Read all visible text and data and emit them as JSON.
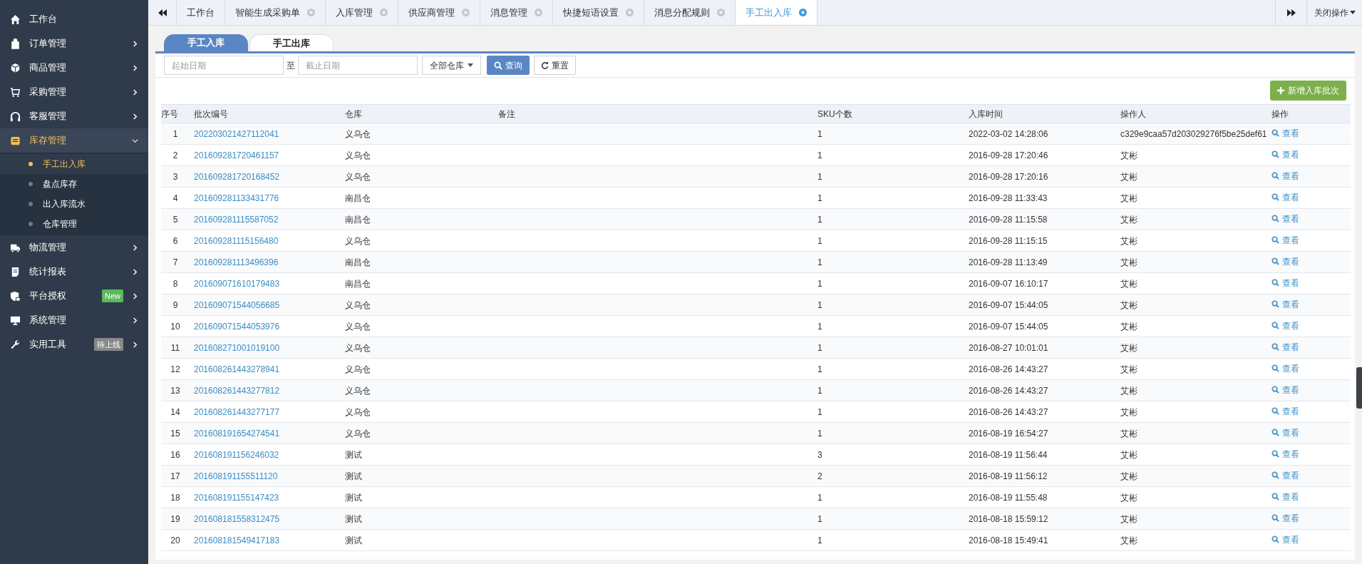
{
  "sidebar": {
    "items": [
      {
        "label": "工作台",
        "kind": "link",
        "selected": false
      },
      {
        "label": "订单管理",
        "kind": "menu",
        "selected": false,
        "expanded": false
      },
      {
        "label": "商品管理",
        "kind": "menu",
        "selected": false,
        "expanded": false
      },
      {
        "label": "采购管理",
        "kind": "menu",
        "selected": false,
        "expanded": false
      },
      {
        "label": "客服管理",
        "kind": "menu",
        "selected": false,
        "expanded": false
      },
      {
        "label": "库存管理",
        "kind": "menu",
        "selected": true,
        "expanded": true,
        "children": [
          {
            "label": "手工出入库",
            "selected": true
          },
          {
            "label": "盘点库存",
            "selected": false
          },
          {
            "label": "出入库流水",
            "selected": false
          },
          {
            "label": "仓库管理",
            "selected": false
          }
        ]
      },
      {
        "label": "物流管理",
        "kind": "menu",
        "selected": false,
        "expanded": false
      },
      {
        "label": "统计报表",
        "kind": "menu",
        "selected": false,
        "expanded": false
      },
      {
        "label": "平台授权",
        "kind": "menu",
        "selected": false,
        "expanded": false,
        "badge": {
          "text": "New",
          "color": "#5cb85c"
        }
      },
      {
        "label": "系统管理",
        "kind": "menu",
        "selected": false,
        "expanded": false
      },
      {
        "label": "实用工具",
        "kind": "menu",
        "selected": false,
        "expanded": false,
        "badge": {
          "text": "待上线",
          "color": "#888888"
        }
      }
    ]
  },
  "tabs": [
    {
      "label": "工作台",
      "selected": false,
      "closable": false
    },
    {
      "label": "智能生成采购单",
      "selected": false,
      "closable": true
    },
    {
      "label": "入库管理",
      "selected": false,
      "closable": true
    },
    {
      "label": "供应商管理",
      "selected": false,
      "closable": true
    },
    {
      "label": "消息管理",
      "selected": false,
      "closable": true
    },
    {
      "label": "快捷短语设置",
      "selected": false,
      "closable": true
    },
    {
      "label": "消息分配规则",
      "selected": false,
      "closable": true
    },
    {
      "label": "手工出入库",
      "selected": true,
      "closable": true
    }
  ],
  "tab_menu": {
    "label": "关闭操作"
  },
  "subtabs": [
    {
      "label": "手工入库",
      "selected": true
    },
    {
      "label": "手工出库",
      "selected": false
    }
  ],
  "filters": {
    "start_date": {
      "placeholder": "起始日期"
    },
    "separator": "至",
    "end_date": {
      "placeholder": "截止日期"
    },
    "warehouse": {
      "value": "全部仓库"
    },
    "query_button": "查询",
    "reset_button": "重置"
  },
  "add_button": "新增入库批次",
  "table": {
    "columns": [
      "序号",
      "批次编号",
      "仓库",
      "备注",
      "SKU个数",
      "入库时间",
      "操作人",
      "操作"
    ],
    "rows": [
      {
        "no": "1",
        "batch": "202203021427112041",
        "warehouse": "义乌仓",
        "sku": "1",
        "time": "2022-03-02 14:28:06",
        "operator": "c329e9caa57d203029276f5be25def61",
        "action": "查看"
      },
      {
        "no": "2",
        "batch": "201609281720461157",
        "warehouse": "义乌仓",
        "sku": "1",
        "time": "2016-09-28 17:20:46",
        "operator": "艾彬",
        "action": "查看"
      },
      {
        "no": "3",
        "batch": "201609281720168452",
        "warehouse": "义乌仓",
        "sku": "1",
        "time": "2016-09-28 17:20:16",
        "operator": "艾彬",
        "action": "查看"
      },
      {
        "no": "4",
        "batch": "201609281133431776",
        "warehouse": "南昌仓",
        "sku": "1",
        "time": "2016-09-28 11:33:43",
        "operator": "艾彬",
        "action": "查看"
      },
      {
        "no": "5",
        "batch": "201609281115587052",
        "warehouse": "南昌仓",
        "sku": "1",
        "time": "2016-09-28 11:15:58",
        "operator": "艾彬",
        "action": "查看"
      },
      {
        "no": "6",
        "batch": "201609281115156480",
        "warehouse": "义乌仓",
        "sku": "1",
        "time": "2016-09-28 11:15:15",
        "operator": "艾彬",
        "action": "查看"
      },
      {
        "no": "7",
        "batch": "201609281113496396",
        "warehouse": "南昌仓",
        "sku": "1",
        "time": "2016-09-28 11:13:49",
        "operator": "艾彬",
        "action": "查看"
      },
      {
        "no": "8",
        "batch": "201609071610179483",
        "warehouse": "南昌仓",
        "sku": "1",
        "time": "2016-09-07 16:10:17",
        "operator": "艾彬",
        "action": "查看"
      },
      {
        "no": "9",
        "batch": "201609071544056685",
        "warehouse": "义乌仓",
        "sku": "1",
        "time": "2016-09-07 15:44:05",
        "operator": "艾彬",
        "action": "查看"
      },
      {
        "no": "10",
        "batch": "201609071544053976",
        "warehouse": "义乌仓",
        "sku": "1",
        "time": "2016-09-07 15:44:05",
        "operator": "艾彬",
        "action": "查看"
      },
      {
        "no": "11",
        "batch": "201608271001019100",
        "warehouse": "义乌仓",
        "sku": "1",
        "time": "2016-08-27 10:01:01",
        "operator": "艾彬",
        "action": "查看"
      },
      {
        "no": "12",
        "batch": "201608261443278941",
        "warehouse": "义乌仓",
        "sku": "1",
        "time": "2016-08-26 14:43:27",
        "operator": "艾彬",
        "action": "查看"
      },
      {
        "no": "13",
        "batch": "201608261443277812",
        "warehouse": "义乌仓",
        "sku": "1",
        "time": "2016-08-26 14:43:27",
        "operator": "艾彬",
        "action": "查看"
      },
      {
        "no": "14",
        "batch": "201608261443277177",
        "warehouse": "义乌仓",
        "sku": "1",
        "time": "2016-08-26 14:43:27",
        "operator": "艾彬",
        "action": "查看"
      },
      {
        "no": "15",
        "batch": "201608191654274541",
        "warehouse": "义乌仓",
        "sku": "1",
        "time": "2016-08-19 16:54:27",
        "operator": "艾彬",
        "action": "查看"
      },
      {
        "no": "16",
        "batch": "201608191156246032",
        "warehouse": "测试",
        "sku": "3",
        "time": "2016-08-19 11:56:44",
        "operator": "艾彬",
        "action": "查看"
      },
      {
        "no": "17",
        "batch": "201608191155511120",
        "warehouse": "测试",
        "sku": "2",
        "time": "2016-08-19 11:56:12",
        "operator": "艾彬",
        "action": "查看"
      },
      {
        "no": "18",
        "batch": "201608191155147423",
        "warehouse": "测试",
        "sku": "1",
        "time": "2016-08-19 11:55:48",
        "operator": "艾彬",
        "action": "查看"
      },
      {
        "no": "19",
        "batch": "201608181558312475",
        "warehouse": "测试",
        "sku": "1",
        "time": "2016-08-18 15:59:12",
        "operator": "艾彬",
        "action": "查看"
      },
      {
        "no": "20",
        "batch": "201608181549417183",
        "warehouse": "测试",
        "sku": "1",
        "time": "2016-08-18 15:49:41",
        "operator": "艾彬",
        "action": "查看"
      }
    ]
  }
}
